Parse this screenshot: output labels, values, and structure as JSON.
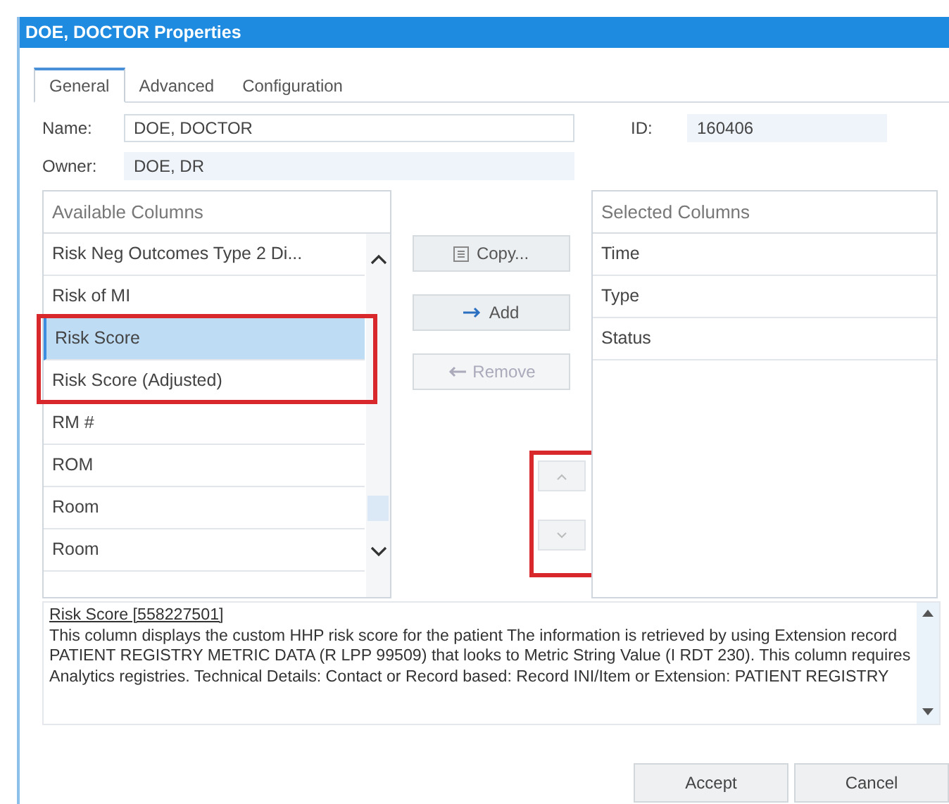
{
  "window": {
    "title": "DOE, DOCTOR Properties"
  },
  "tabs": [
    {
      "label": "General",
      "selected": true
    },
    {
      "label": "Advanced",
      "selected": false
    },
    {
      "label": "Configuration",
      "selected": false
    }
  ],
  "fields": [
    {
      "label": "Name:",
      "value": "DOE, DOCTOR"
    },
    {
      "label": "Owner:",
      "value": "DOE, DR"
    }
  ],
  "id_field": {
    "label": "ID:",
    "value": "160406"
  },
  "available_columns": {
    "heading": "Available Columns",
    "rows": [
      {
        "label": "Risk Neg Outcomes Type 2 Di...",
        "selected": false
      },
      {
        "label": "Risk of MI",
        "selected": false
      },
      {
        "label": "Risk Score",
        "selected": true,
        "highlighted": true
      },
      {
        "label": "Risk Score (Adjusted)",
        "selected": false,
        "highlighted": true
      },
      {
        "label": "RM #",
        "selected": false
      },
      {
        "label": "ROM",
        "selected": false
      },
      {
        "label": "Room",
        "selected": false
      },
      {
        "label": "Room",
        "selected": false
      }
    ]
  },
  "actions": [
    {
      "kind": "copy",
      "label": "Copy...",
      "disabled": false
    },
    {
      "kind": "add",
      "label": "Add",
      "disabled": false
    },
    {
      "kind": "remove",
      "label": "Remove",
      "disabled": true
    }
  ],
  "order_buttons": [
    {
      "kind": "up",
      "disabled": true
    },
    {
      "kind": "down",
      "disabled": true
    }
  ],
  "order_highlighted": true,
  "selected_columns": {
    "heading": "Selected Columns",
    "rows": [
      {
        "label": "Time",
        "selected": false
      },
      {
        "label": "Type",
        "selected": false
      },
      {
        "label": "Status",
        "selected": false
      }
    ]
  },
  "description": {
    "title": "Risk Score [558227501]",
    "text": "This column displays the custom HHP risk score for the patient The information is retrieved by using Extension record PATIENT REGISTRY METRIC DATA (R LPP 99509) that looks to Metric String Value (I RDT 230). This column requires Analytics registries. Technical Details: Contact or Record based: Record INI/Item or Extension: PATIENT REGISTRY"
  },
  "footer_buttons": [
    "Accept",
    "Cancel"
  ]
}
